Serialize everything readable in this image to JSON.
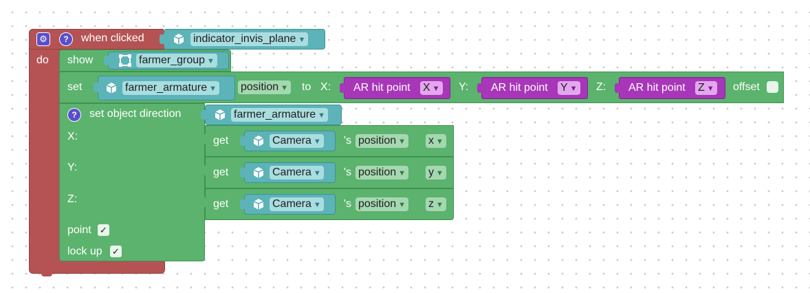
{
  "event_block": {
    "settings_icon": "gear-icon",
    "help_icon": "question-icon",
    "label": "when clicked",
    "object": "indicator_invis_plane",
    "do_label": "do"
  },
  "show_block": {
    "label": "show",
    "object": "farmer_group"
  },
  "set_block": {
    "label": "set",
    "object": "farmer_armature",
    "property": "position",
    "to_label": "to",
    "x_label": "X:",
    "y_label": "Y:",
    "z_label": "Z:",
    "ar_hit_label": "AR hit point",
    "ar_x": "X",
    "ar_y": "Y",
    "ar_z": "Z",
    "offset_label": "offset"
  },
  "direction_block": {
    "help_icon": "question-icon",
    "label": "set object direction",
    "object": "farmer_armature",
    "x_label": "X:",
    "y_label": "Y:",
    "z_label": "Z:",
    "point_label": "point",
    "lockup_label": "lock up",
    "point_checked": "✓",
    "lockup_checked": "✓"
  },
  "get_blocks": [
    {
      "get": "get",
      "object": "Camera",
      "sep": "'s",
      "prop": "position",
      "axis": "x"
    },
    {
      "get": "get",
      "object": "Camera",
      "sep": "'s",
      "prop": "position",
      "axis": "y"
    },
    {
      "get": "get",
      "object": "Camera",
      "sep": "'s",
      "prop": "position",
      "axis": "z"
    }
  ],
  "dropdown_caret": "▼"
}
